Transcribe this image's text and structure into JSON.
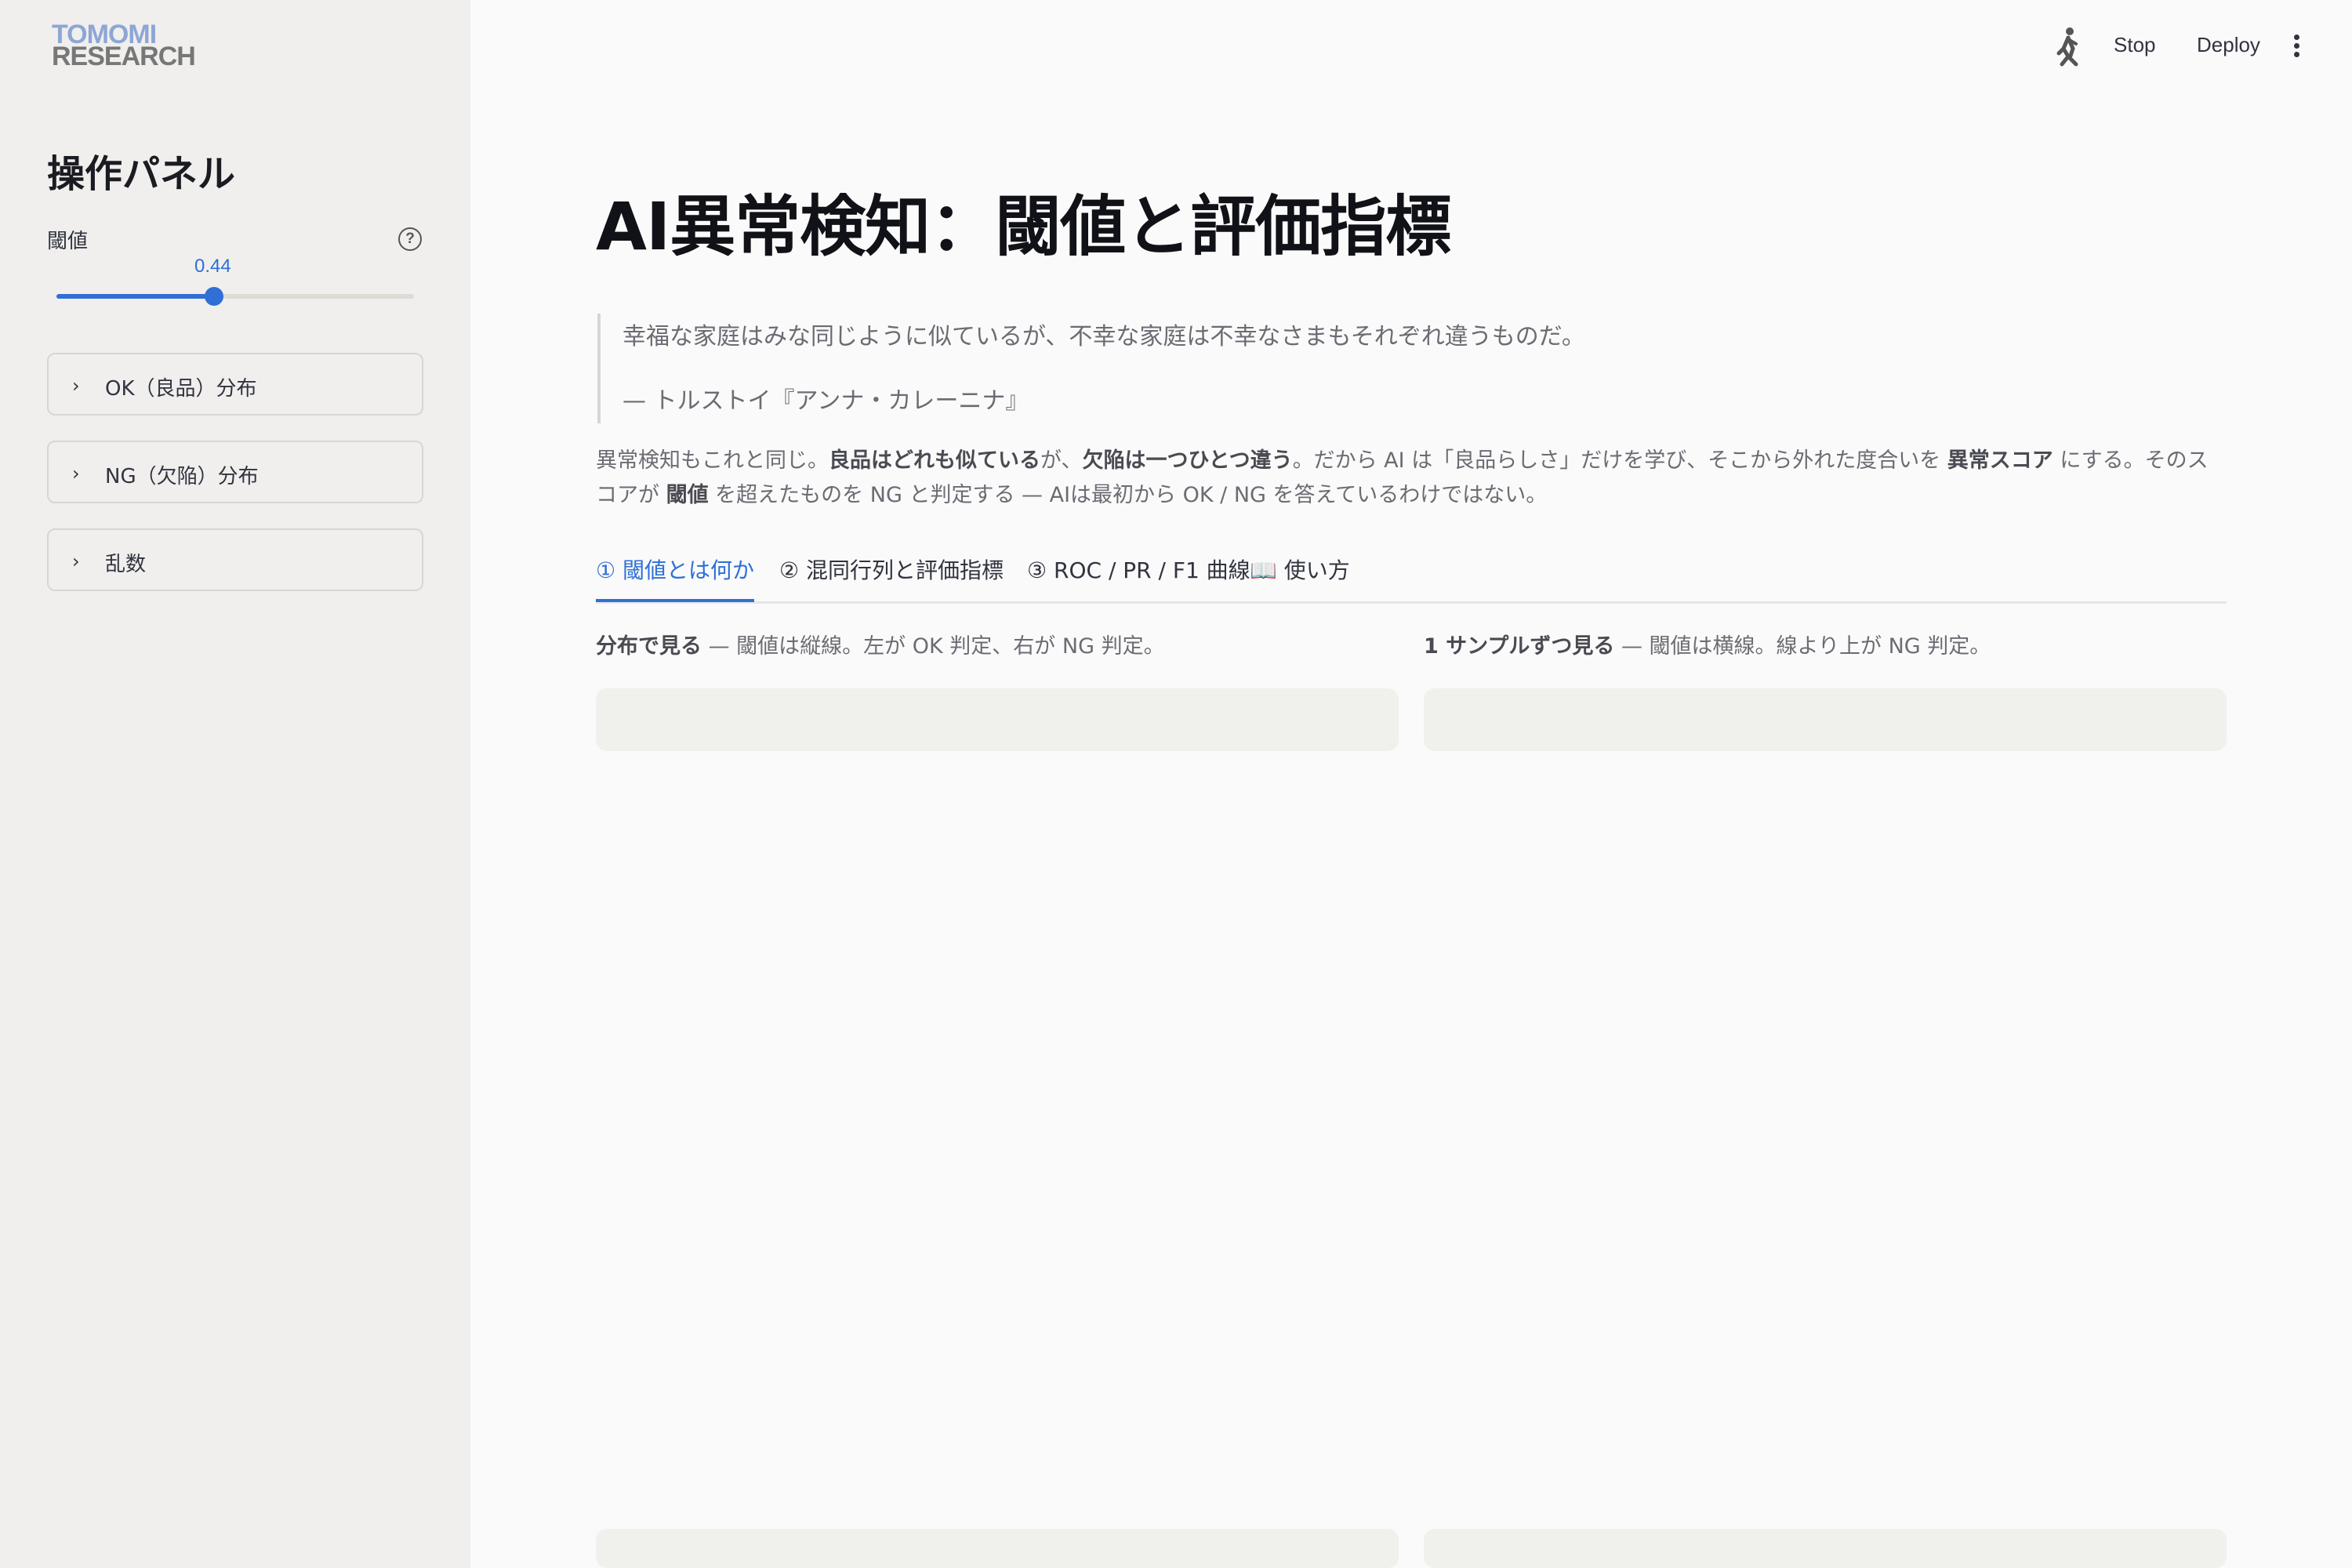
{
  "sidebar": {
    "logo": {
      "line1": "TOMOMI",
      "line2": "RESEARCH"
    },
    "panel_title": "操作パネル",
    "slider": {
      "label": "閾値",
      "value": 0.44,
      "value_text": "0.44",
      "min": 0,
      "max": 1
    },
    "expanders": [
      {
        "label": "OK（良品）分布"
      },
      {
        "label": "NG（欠陥）分布"
      },
      {
        "label": "乱数"
      }
    ]
  },
  "toolbar": {
    "stop_label": "Stop",
    "deploy_label": "Deploy"
  },
  "main": {
    "title": "AI異常検知：閾値と評価指標",
    "quote": {
      "text": "幸福な家庭はみな同じように似ているが、不幸な家庭は不幸なさまもそれぞれ違うものだ。",
      "cite": "— トルストイ『アンナ・カレーニナ』"
    },
    "intro": {
      "p1": "異常検知もこれと同じ。",
      "b1": "良品はどれも似ている",
      "p2": "が、",
      "b2": "欠陥は一つひとつ違う",
      "p3": "。だから AI は「良品らしさ」だけを学び、そこから外れた度合いを ",
      "b3": "異常スコア",
      "p4": " にする。そのスコアが ",
      "b4": "閾値",
      "p5": " を超えたものを NG と判定する — AIは最初から OK / NG を答えているわけではない。"
    },
    "tabs": [
      {
        "label": "① 閾値とは何か",
        "active": true
      },
      {
        "label": "② 混同行列と評価指標",
        "active": false
      },
      {
        "label": "③ ROC / PR / F1 曲線",
        "active": false
      },
      {
        "label": "📖 使い方",
        "active": false
      }
    ],
    "left_caption": {
      "bold": "分布で見る",
      "rest": " — 閾値は縦線。左が OK 判定、右が NG 判定。"
    },
    "right_caption": {
      "bold": "1 サンプルずつ見る",
      "rest": " — 閾値は横線。線より上が NG 判定。"
    }
  },
  "colors": {
    "accent": "#2f6fd6",
    "sidebar_bg": "#f0efed",
    "main_bg": "#fafafa"
  }
}
